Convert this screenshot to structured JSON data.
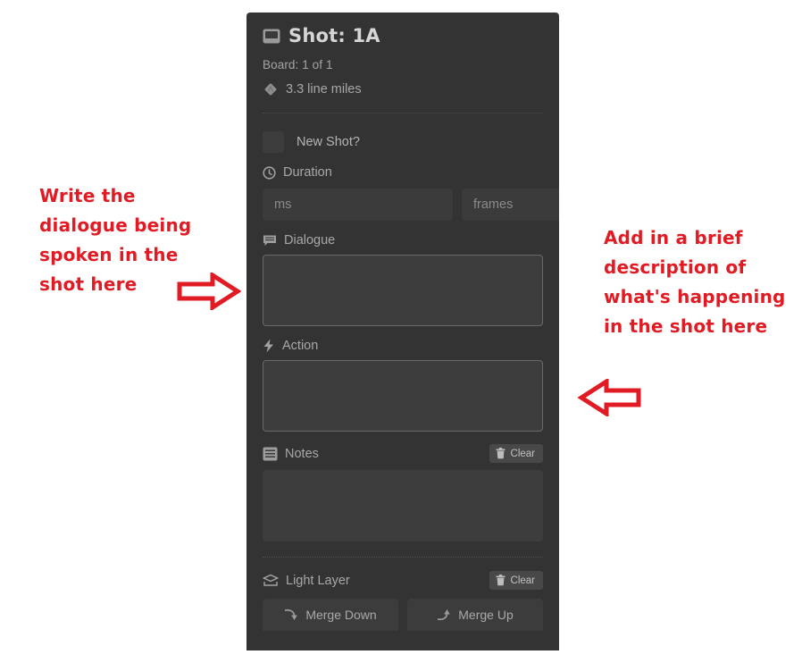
{
  "panel": {
    "header": {
      "icon": "board-icon",
      "title": "Shot: 1A",
      "board_line": "Board: 1 of 1",
      "line_miles_icon": "diamond-icon",
      "line_miles": "3.3 line miles"
    },
    "new_shot": {
      "label": "New Shot?",
      "checked": false
    },
    "duration": {
      "icon": "clock-icon",
      "label": "Duration",
      "ms_value": "",
      "ms_placeholder": "ms",
      "frames_value": "",
      "frames_placeholder": "frames"
    },
    "dialogue": {
      "icon": "speech-bubble-icon",
      "label": "Dialogue",
      "value": "",
      "placeholder": ""
    },
    "action": {
      "icon": "lightning-bolt-icon",
      "label": "Action",
      "value": "",
      "placeholder": ""
    },
    "notes": {
      "icon": "list-icon",
      "label": "Notes",
      "clear_label": "Clear",
      "clear_icon": "trash-icon",
      "value": "",
      "placeholder": ""
    },
    "light_layer": {
      "icon": "layer-icon",
      "label": "Light Layer",
      "clear_label": "Clear",
      "clear_icon": "trash-icon",
      "merge_down_label": "Merge Down",
      "merge_down_icon": "arrow-down-right-icon",
      "merge_up_label": "Merge Up",
      "merge_up_icon": "arrow-up-right-icon"
    }
  },
  "annotations": {
    "left_text": "Write the dialogue being spoken in the shot here",
    "left_arrow_icon": "arrow-right-callout-icon",
    "right_text": "Add in a brief description of what's happening in the shot here",
    "right_arrow_icon": "arrow-left-callout-icon"
  },
  "colors": {
    "panel_bg": "#333333",
    "annotation_red": "#e01b24",
    "input_bg": "#3b3b3b",
    "page_bg": "#ffffff"
  }
}
